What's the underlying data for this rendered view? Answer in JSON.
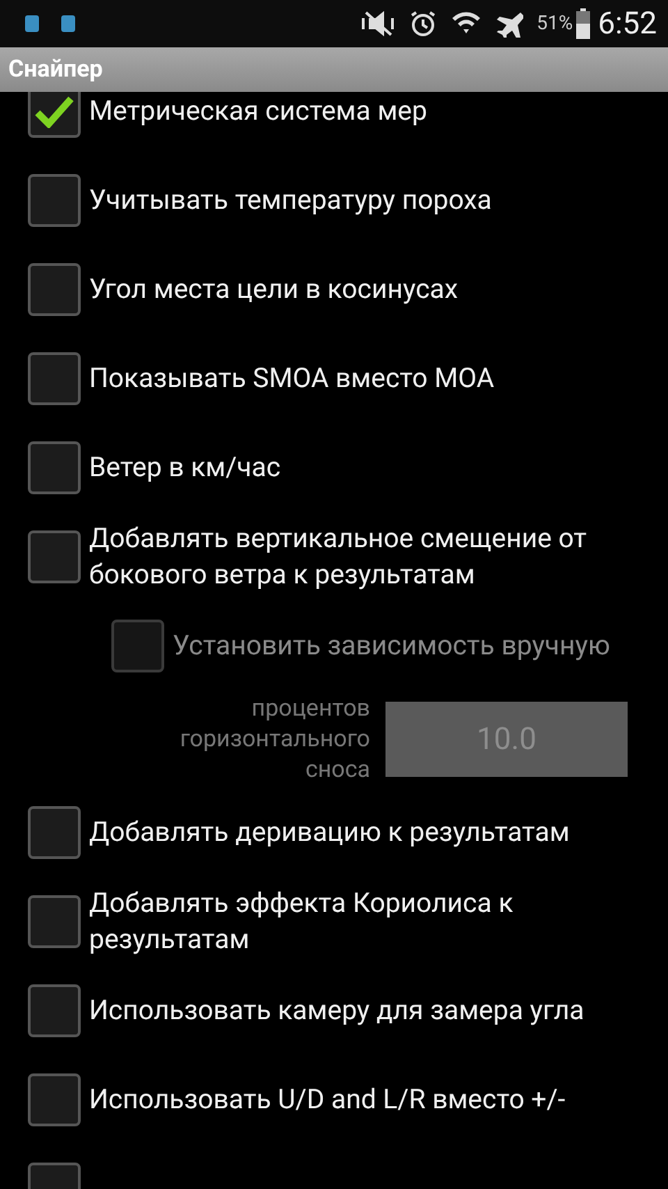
{
  "status_bar": {
    "battery": "51%",
    "time": "6:52"
  },
  "title_bar": {
    "title": "Снайпер"
  },
  "preferences": [
    {
      "kind": "checkbox",
      "label": "Метрическая система мер",
      "checked": true,
      "disabled": false,
      "indented": false
    },
    {
      "kind": "checkbox",
      "label": "Учитывать температуру пороха",
      "checked": false,
      "disabled": false,
      "indented": false
    },
    {
      "kind": "checkbox",
      "label": "Угол места цели в косинусах",
      "checked": false,
      "disabled": false,
      "indented": false
    },
    {
      "kind": "checkbox",
      "label": "Показывать SMOA вместо MOA",
      "checked": false,
      "disabled": false,
      "indented": false
    },
    {
      "kind": "checkbox",
      "label": "Ветер в км/час",
      "checked": false,
      "disabled": false,
      "indented": false
    },
    {
      "kind": "checkbox",
      "label": "Добавлять вертикальное смещение от бокового ветра к результатам",
      "checked": false,
      "disabled": false,
      "indented": false
    },
    {
      "kind": "checkbox",
      "label": "Установить зависимость вручную",
      "checked": false,
      "disabled": true,
      "indented": true
    },
    {
      "kind": "input",
      "label": "процентов горизонтального сноса",
      "value": "10.0",
      "disabled": true
    },
    {
      "kind": "checkbox",
      "label": "Добавлять деривацию к результатам",
      "checked": false,
      "disabled": false,
      "indented": false
    },
    {
      "kind": "checkbox",
      "label": "Добавлять эффекта Кориолиса к результатам",
      "checked": false,
      "disabled": false,
      "indented": false
    },
    {
      "kind": "checkbox",
      "label": "Использовать камеру для замера угла",
      "checked": false,
      "disabled": false,
      "indented": false
    },
    {
      "kind": "checkbox",
      "label": "Использовать U/D and L/R вместо +/-",
      "checked": false,
      "disabled": false,
      "indented": false
    },
    {
      "kind": "checkbox",
      "checked": false,
      "disabled": false,
      "indented": false
    }
  ]
}
